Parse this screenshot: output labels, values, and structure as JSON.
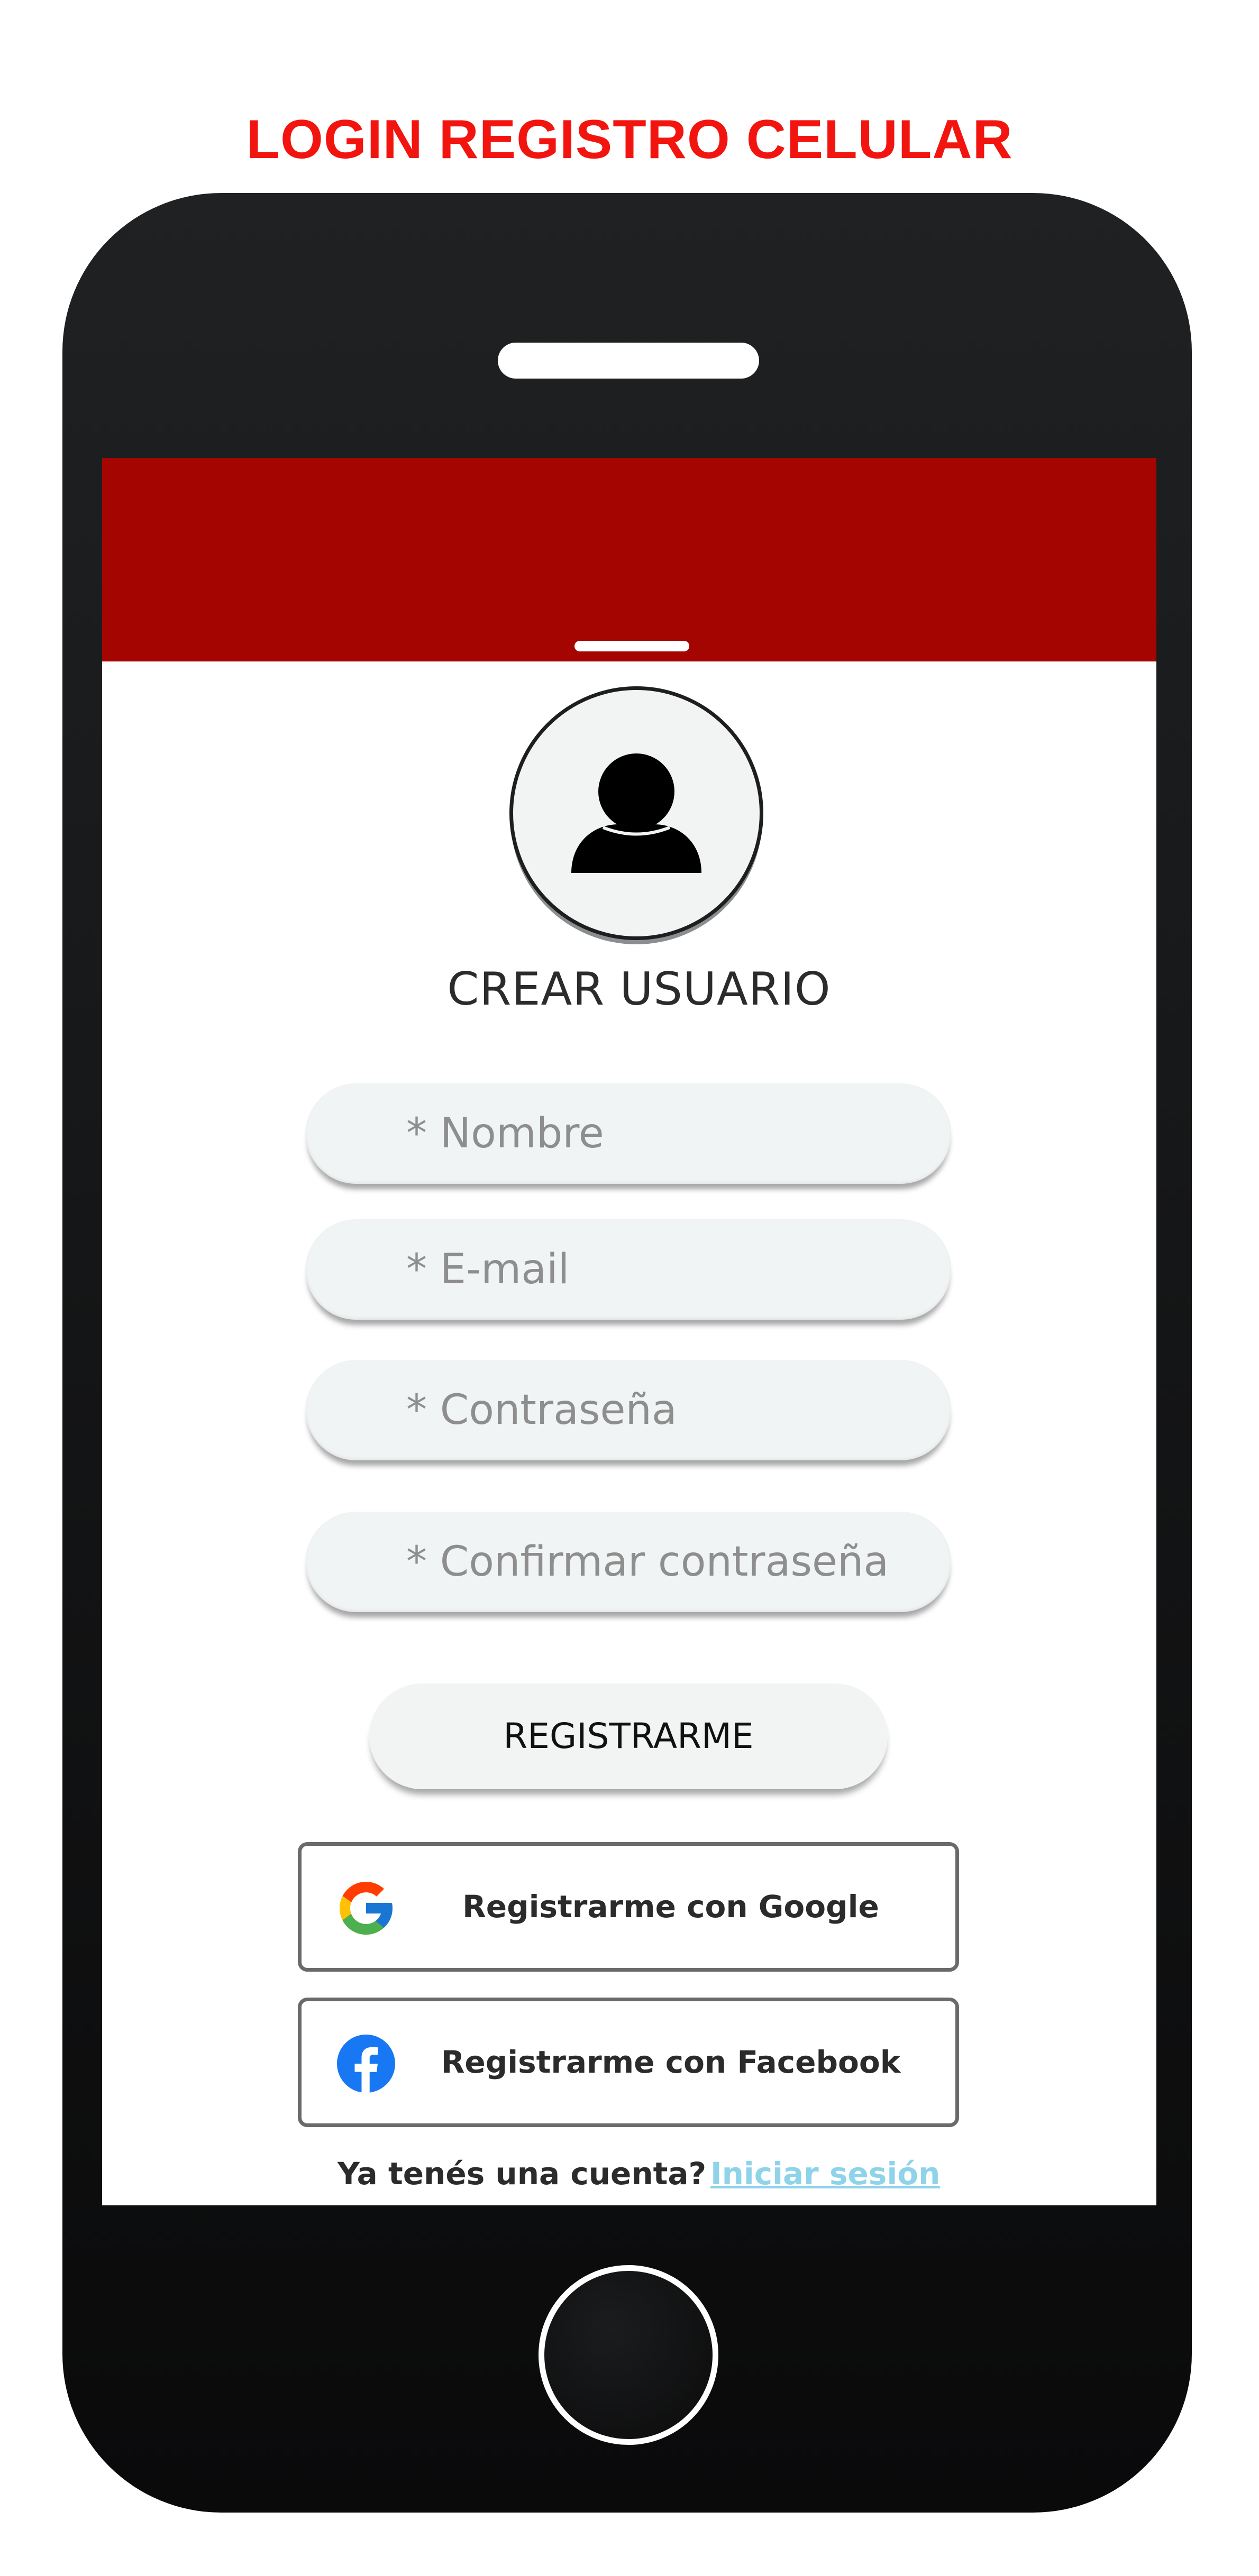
{
  "page": {
    "title": "LOGIN REGISTRO CELULAR"
  },
  "form": {
    "title": "CREAR USUARIO",
    "fields": [
      {
        "placeholder": "* Nombre"
      },
      {
        "placeholder": "* E-mail"
      },
      {
        "placeholder": "* Contraseña"
      },
      {
        "placeholder": "* Confirmar contraseña"
      }
    ],
    "submit_label": "REGISTRARME"
  },
  "social": {
    "google_label": "Registrarme con Google",
    "facebook_label": "Registrarme con Facebook"
  },
  "footer": {
    "prompt": "Ya tenés una cuenta?",
    "login_link": "Iniciar sesión"
  },
  "colors": {
    "title_red": "#f2150f",
    "header_red": "#a50500",
    "phone_body": "#141516",
    "link_blue": "#8fd3ea",
    "facebook_blue": "#1877f2"
  },
  "icons": {
    "avatar": "user-icon",
    "google": "google-icon",
    "facebook": "facebook-icon"
  }
}
